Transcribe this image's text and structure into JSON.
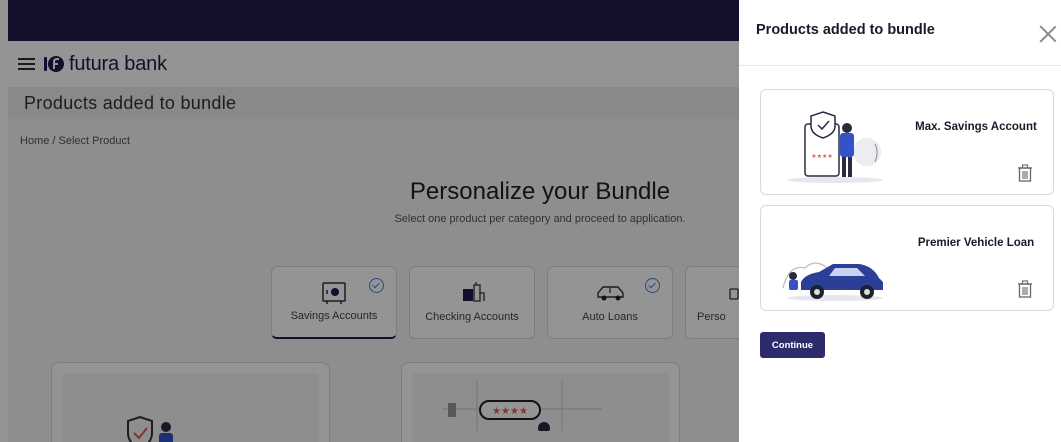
{
  "app": {
    "brand_name": "futura bank",
    "page_title": "Products added to bundle",
    "breadcrumb": "Home / Select Product"
  },
  "hero": {
    "title": "Personalize your Bundle",
    "subtitle": "Select one product per category and proceed to application."
  },
  "categories": [
    {
      "label": "Savings Accounts",
      "icon": "safe-icon",
      "selected": true
    },
    {
      "label": "Checking Accounts",
      "icon": "checking-icon",
      "selected": false
    },
    {
      "label": "Auto Loans",
      "icon": "car-icon",
      "selected": true
    },
    {
      "label": "Perso",
      "icon": "personal-loan-icon",
      "selected": false
    }
  ],
  "drawer": {
    "title": "Products added to bundle",
    "items": [
      {
        "name": "Max. Savings Account",
        "icon": "savings-illustration"
      },
      {
        "name": "Premier Vehicle Loan",
        "icon": "vehicle-illustration"
      }
    ],
    "continue_label": "Continue"
  },
  "colors": {
    "header_dark": "#1f1c4a",
    "accent_blue": "#4a7ee8",
    "button": "#2d2b6b"
  }
}
